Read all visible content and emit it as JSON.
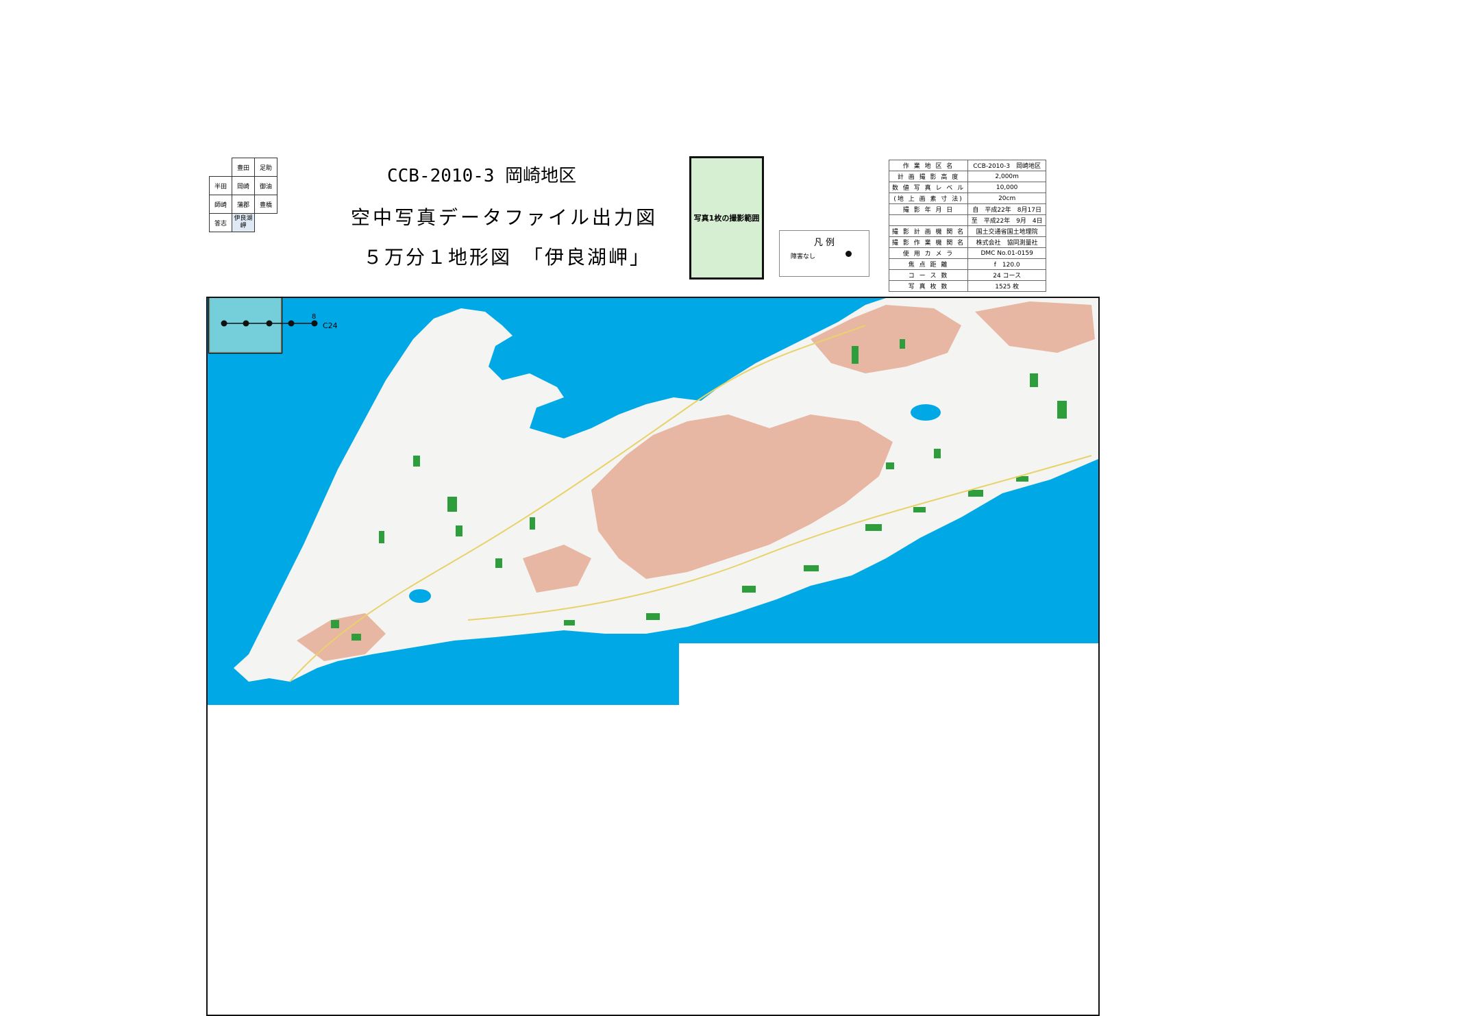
{
  "index_grid": {
    "rows": [
      [
        "",
        "豊田",
        "足助"
      ],
      [
        "半田",
        "岡崎",
        "御油"
      ],
      [
        "師崎",
        "蒲郡",
        "豊橋"
      ],
      [
        "答志",
        "伊良湖岬",
        ""
      ]
    ],
    "current": "伊良湖岬"
  },
  "title": {
    "line1": "CCB-2010-3 岡崎地区",
    "line2": "空中写真データファイル出力図",
    "line3": "５万分１地形図　「伊良湖岬」"
  },
  "extent_box": {
    "label": "写真1枚の撮影範囲"
  },
  "legend": {
    "title": "凡 例",
    "item": "障害なし"
  },
  "info_table": [
    {
      "key": "作 業 地 区 名",
      "value": "CCB-2010-3　岡崎地区"
    },
    {
      "key": "計 画 撮 影 高 度",
      "value": "2,000m"
    },
    {
      "key": "数 値 写 真 レ ベ ル",
      "value": "10,000"
    },
    {
      "key": "(地 上 画 素 寸 法)",
      "value": "20cm"
    },
    {
      "key": "撮 影 年 月 日",
      "value": "自　平成22年　8月17日"
    },
    {
      "key": "",
      "value": "至　平成22年　9月　4日"
    },
    {
      "key": "撮 影 計 画 機 関 名",
      "value": "国土交通省国土地理院"
    },
    {
      "key": "撮 影 作 業 機 関 名",
      "value": "株式会社　協同測量社"
    },
    {
      "key": "使 用 カ メ ラ",
      "value": "DMC No.01-0159"
    },
    {
      "key": "焦 点 距 離",
      "value": "f　120.0"
    },
    {
      "key": "コ ー ス 数",
      "value": "24 コース"
    },
    {
      "key": "写 真 枚 数",
      "value": "1525 枚"
    }
  ],
  "map": {
    "course_label": "C24",
    "photo_number": "8",
    "colors": {
      "sea": "#00a9e6",
      "land": "#f4f4f2",
      "hills": "#e7b7a4",
      "forest": "#2e9e3c",
      "extent_fill": "#d6eed2",
      "frame": "#111111"
    }
  }
}
